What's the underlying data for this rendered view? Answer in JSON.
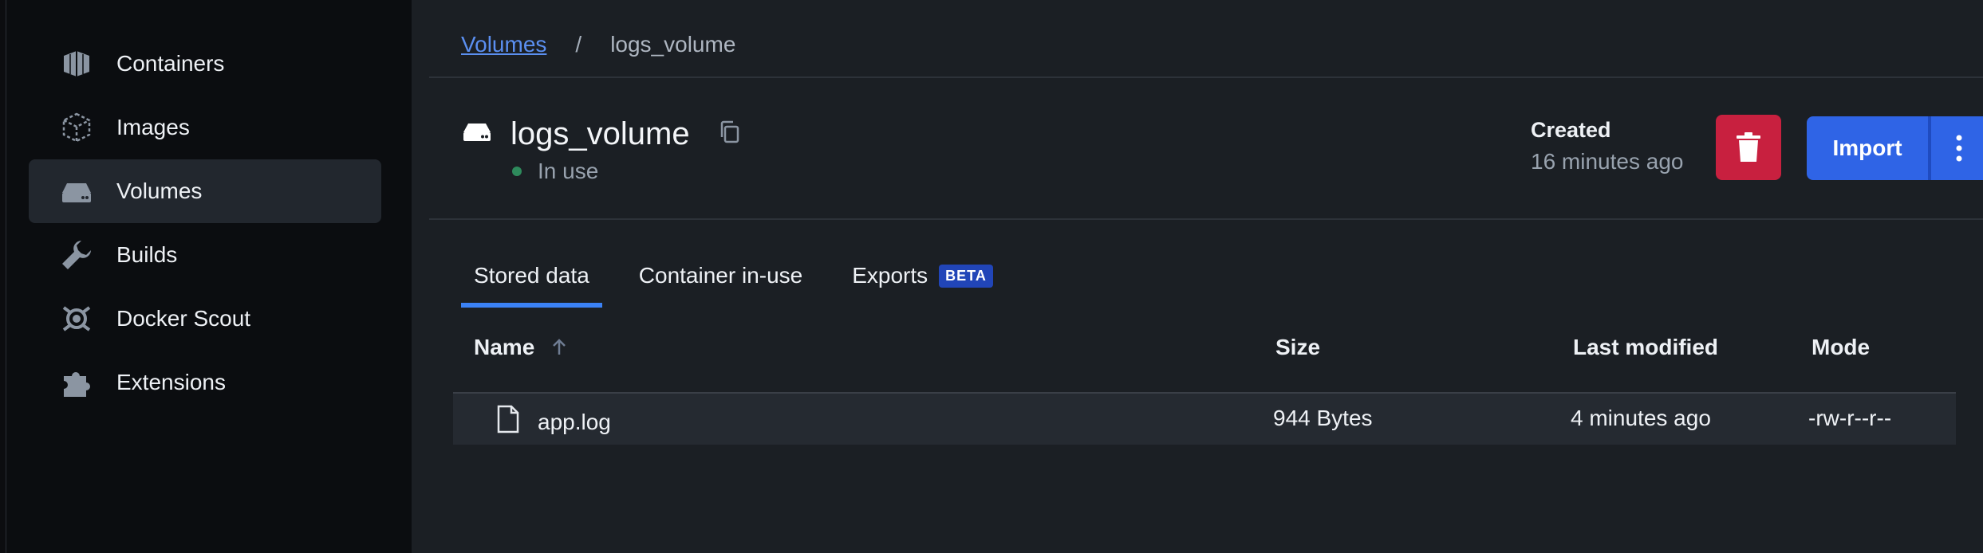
{
  "sidebar": {
    "items": [
      {
        "label": "Containers",
        "icon": "containers-icon"
      },
      {
        "label": "Images",
        "icon": "images-icon"
      },
      {
        "label": "Volumes",
        "icon": "volumes-icon",
        "active": true
      },
      {
        "label": "Builds",
        "icon": "wrench-icon"
      },
      {
        "label": "Docker Scout",
        "icon": "scout-icon"
      },
      {
        "label": "Extensions",
        "icon": "puzzle-icon"
      }
    ]
  },
  "breadcrumb": {
    "parent": "Volumes",
    "separator": "/",
    "current": "logs_volume"
  },
  "volume": {
    "name": "logs_volume",
    "status": "In use",
    "created_label": "Created",
    "created_value": "16 minutes ago"
  },
  "actions": {
    "import_label": "Import"
  },
  "tabs": [
    {
      "label": "Stored data",
      "active": true
    },
    {
      "label": "Container in-use"
    },
    {
      "label": "Exports",
      "badge": "BETA"
    }
  ],
  "table": {
    "columns": [
      "Name",
      "Size",
      "Last modified",
      "Mode"
    ],
    "rows": [
      {
        "name": "app.log",
        "size": "944 Bytes",
        "modified": "4 minutes ago",
        "mode": "-rw-r--r--"
      }
    ]
  },
  "colors": {
    "accent": "#2f64e6",
    "danger": "#c8203f",
    "status_green": "#2e8a5c",
    "link": "#5b8ff0"
  }
}
